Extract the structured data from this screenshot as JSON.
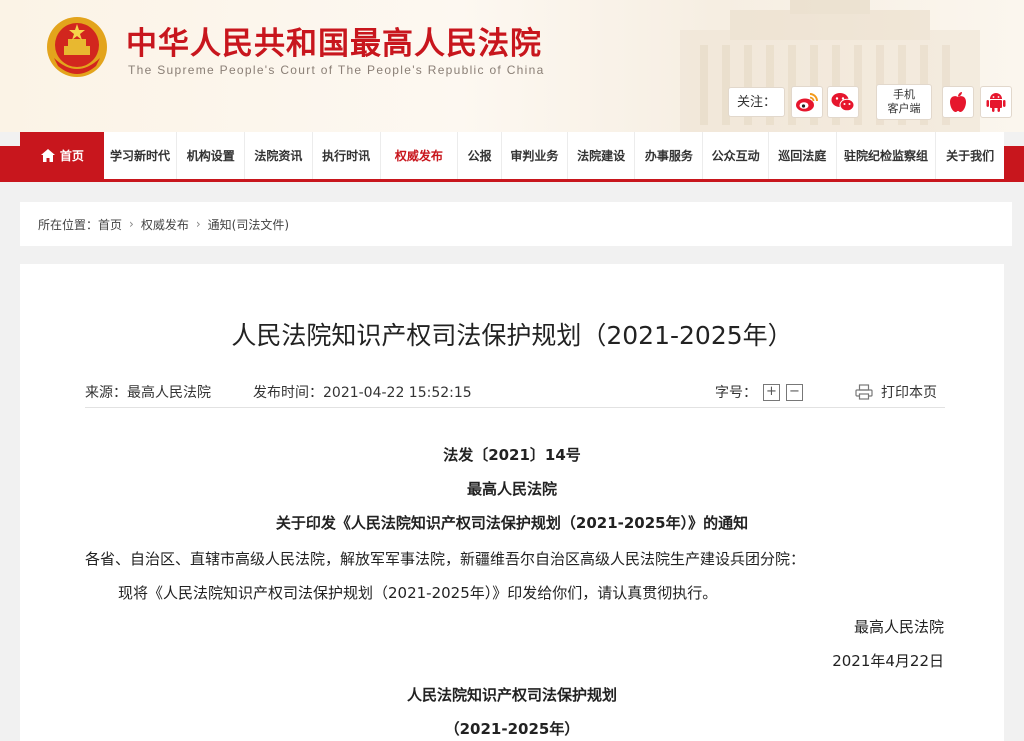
{
  "header": {
    "title": "中华人民共和国最高人民法院",
    "subtitle": "The Supreme People's Court of The People's Republic of China",
    "follow_label": "关注：",
    "mobile_line1": "手机",
    "mobile_line2": "客户端",
    "icons": [
      "weibo-icon",
      "wechat-icon",
      "apple-icon",
      "android-icon"
    ]
  },
  "nav": {
    "home": "首页",
    "items": [
      "学习新时代",
      "机构设置",
      "法院资讯",
      "执行时讯",
      "权威发布",
      "公报",
      "审判业务",
      "法院建设",
      "办事服务",
      "公众互动",
      "巡回法庭",
      "驻院纪检监察组",
      "关于我们"
    ],
    "active_index": 4
  },
  "breadcrumb": {
    "prefix": "所在位置：",
    "items": [
      "首页",
      "权威发布",
      "通知(司法文件)"
    ]
  },
  "article": {
    "title": "人民法院知识产权司法保护规划（2021-2025年）",
    "source": "来源：最高人民法院",
    "time": "发布时间：2021-04-22 15:52:15",
    "font_size_label": "字号：",
    "font_inc": "+",
    "font_dec": "−",
    "print": "打印本页",
    "doc_number": "法发〔2021〕14号",
    "issuer": "最高人民法院",
    "notice_title": "关于印发《人民法院知识产权司法保护规划（2021-2025年）》的通知",
    "addressee": "各省、自治区、直辖市高级人民法院，解放军军事法院，新疆维吾尔自治区高级人民法院生产建设兵团分院：",
    "body": "现将《人民法院知识产权司法保护规划（2021-2025年）》印发给你们，请认真贯彻执行。",
    "sign": "最高人民法院",
    "date": "2021年4月22日",
    "sub_title": "人民法院知识产权司法保护规划",
    "sub_period": "（2021-2025年）"
  },
  "colors": {
    "brand_red": "#c8161d"
  }
}
